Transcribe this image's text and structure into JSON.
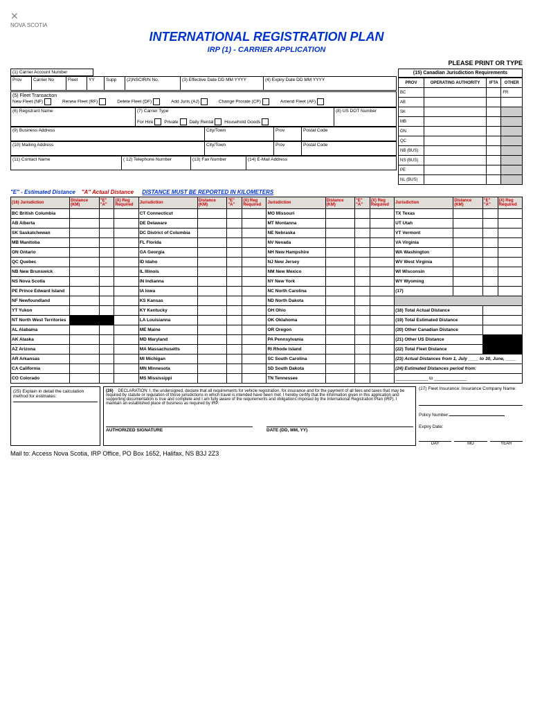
{
  "logo": "NOVA SCOTIA",
  "title": "INTERNATIONAL REGISTRATION PLAN",
  "subtitle": "IRP (1) - CARRIER APPLICATION",
  "print_type": "PLEASE PRINT OR TYPE",
  "carrier_account": "(1) Carrier Account Number",
  "row1": {
    "prov": "Prov",
    "carrier_no": "Carrier No",
    "fleet": "Fleet",
    "yy": "YY",
    "supp": "Supp",
    "nscirn": "(2)NSCIR/N No.",
    "effective": "(3)  Effective Date   DD  MM  YYYY",
    "expiry": "(4)      Expiry Date   DD  MM  YYYY"
  },
  "fleet_trans": {
    "label": "(5) Fleet Transaction",
    "new": "New Fleet (NF)",
    "renew": "Renew Fleet (RF)",
    "delete": "Delete Fleet (DF)",
    "add": "Add Juris (AJ)",
    "change": "Change Prorate (CP)",
    "amend": "Amend Fleet (AF)"
  },
  "registrant": {
    "name": "(6) Registrant Name",
    "carrier_type": "(7) Carrier Type",
    "for_hire": "For Hire",
    "private": "Private",
    "daily": "Daily Rental",
    "household": "Household Goods",
    "usdot": "(8) US DOT Number"
  },
  "business": {
    "label": "(9)  Business Address",
    "city": "City/Town",
    "prov": "Prov",
    "postal": "Postal Code"
  },
  "mailing": {
    "label": "(10)  Mailing Address",
    "city": "City/Town",
    "prov": "Prov",
    "postal": "Postal Code"
  },
  "contact": {
    "name": "(11)  Contact Name",
    "tel": "( 12)  Telephone Number",
    "fax": "(13) Fax Number",
    "email": "(14)  E-Mail Address"
  },
  "canadian_req": {
    "title": "(15) Canadian Jurisdiction Requirements",
    "cols": [
      "PROV",
      "OPERATING AUTHORITY",
      "IFTA",
      "OTHER"
    ],
    "rows": [
      "BC",
      "AB",
      "SK",
      "MB",
      "ON",
      "QC",
      "NB (BUS)",
      "NS (BUS)",
      "PE",
      "NL (BUS)"
    ],
    "bc_other": "FR"
  },
  "legend": {
    "e": "\"E\" - Estimated Distance",
    "a": "\"A\" Actual Distance",
    "km": "DISTANCE MUST BE REPORTED IN KILOMETERS"
  },
  "jur_headers": {
    "num": "(16)",
    "jur": "Jurisdiction",
    "dist": "Distance (KM)",
    "ea": "\"E\" \"A\"",
    "xreg": "(X) Reg Required"
  },
  "col1": [
    {
      "code": "BC",
      "name": "British Columbia"
    },
    {
      "code": "AB",
      "name": "Alberta"
    },
    {
      "code": "SK",
      "name": "Saskatchewan"
    },
    {
      "code": "MB",
      "name": "Manitoba"
    },
    {
      "code": "ON",
      "name": "Ontario"
    },
    {
      "code": "QC",
      "name": "Quebec"
    },
    {
      "code": "NB",
      "name": "New Brunswick"
    },
    {
      "code": "NS",
      "name": "Nova Scotia"
    },
    {
      "code": "PE",
      "name": "Prince Edward Island"
    },
    {
      "code": "NF",
      "name": "Newfoundland"
    },
    {
      "code": "YT",
      "name": "Yukon"
    },
    {
      "code": "NT",
      "name": "North West Territories"
    },
    {
      "code": "AL",
      "name": "Alabama"
    },
    {
      "code": "AK",
      "name": "Alaska"
    },
    {
      "code": "AZ",
      "name": "Arizona"
    },
    {
      "code": "AR",
      "name": "Arkansas"
    },
    {
      "code": "CA",
      "name": "California"
    },
    {
      "code": "CO",
      "name": "Colorado"
    }
  ],
  "col2": [
    {
      "code": "CT",
      "name": "Connecticut"
    },
    {
      "code": "DE",
      "name": "Delaware"
    },
    {
      "code": "DC",
      "name": "District of Columbia"
    },
    {
      "code": "FL",
      "name": "Florida"
    },
    {
      "code": "GA",
      "name": "Georgia"
    },
    {
      "code": "ID",
      "name": "Idaho"
    },
    {
      "code": "IL",
      "name": "Illinois"
    },
    {
      "code": "IN",
      "name": "Indianna"
    },
    {
      "code": "IA",
      "name": "Iowa"
    },
    {
      "code": "KS",
      "name": "Kansas"
    },
    {
      "code": "KY",
      "name": "Kentucky"
    },
    {
      "code": "LA",
      "name": "Louisianna"
    },
    {
      "code": "ME",
      "name": "Maine"
    },
    {
      "code": "MD",
      "name": "Maryland"
    },
    {
      "code": "MA",
      "name": "Massachusetts"
    },
    {
      "code": "MI",
      "name": "Michigan"
    },
    {
      "code": "MN",
      "name": "Minnesota"
    },
    {
      "code": "MS",
      "name": "Mississippi"
    }
  ],
  "col3": [
    {
      "code": "MO",
      "name": "Missouri"
    },
    {
      "code": "MT",
      "name": "Montanna"
    },
    {
      "code": "NE",
      "name": "Nebraska"
    },
    {
      "code": "NV",
      "name": "Nevada"
    },
    {
      "code": "NH",
      "name": "New Hampshire"
    },
    {
      "code": "NJ",
      "name": "New Jersey"
    },
    {
      "code": "NM",
      "name": "New Mexico"
    },
    {
      "code": "NY",
      "name": "New York"
    },
    {
      "code": "NC",
      "name": "North Carolina"
    },
    {
      "code": "ND",
      "name": "North Dakota"
    },
    {
      "code": "OH",
      "name": "Ohio"
    },
    {
      "code": "OK",
      "name": "Oklahoma"
    },
    {
      "code": "OR",
      "name": "Oregon"
    },
    {
      "code": "PA",
      "name": "Pennsylvania"
    },
    {
      "code": "RI",
      "name": "Rhode Island"
    },
    {
      "code": "SC",
      "name": "South Carolina"
    },
    {
      "code": "SD",
      "name": "South Dakota"
    },
    {
      "code": "TN",
      "name": "Tennessee"
    }
  ],
  "col4": [
    {
      "code": "TX",
      "name": "Texas"
    },
    {
      "code": "UT",
      "name": "Utah"
    },
    {
      "code": "VT",
      "name": "Vermont"
    },
    {
      "code": "VA",
      "name": "Virginia"
    },
    {
      "code": "WA",
      "name": "Washington"
    },
    {
      "code": "WV",
      "name": "West Virginia"
    },
    {
      "code": "WI",
      "name": "Wisconsin"
    },
    {
      "code": "WY",
      "name": "Wyoming"
    }
  ],
  "totals": {
    "r17": "(17)",
    "r18": "(18)  Total Actual Distance",
    "r19": "(19)  Total Estimated Distance",
    "r20": "(20)  Other Canadian Distance",
    "r21": "(21)  Other US Distance",
    "r22": "(22)  Total Fleet Distance",
    "r23": "(23)  Actual Distances from 1, July ____ to 30, June, ____",
    "r24": "(24)  Estimated Distances period from:",
    "r24b": "_____________ to _____________"
  },
  "box25": {
    "label": "(25) Explain in detail the calculation method for estimates:"
  },
  "box26": {
    "label": "(26)",
    "decl_title": "DECLARATION:",
    "text": "I, the undersigned, declare that all requirements for vehicle registration, for insurance and for the payment of all fees and taxes that may be required by statute or regulation of those jurisdictions in which travel is intended have been met.  I hereby certify that the information  given in this application and supporting documentation is true and complete  and I am fully aware of the requirements and obligations imposed by the International Registration Plan (IRP).  I maintain an established place of business as required by IRP.",
    "sig": "AUTHORIZED SIGNATURE",
    "date": "DATE (DD, MM, YY)"
  },
  "box27": {
    "label": "(27)  Fleet Insurance:   Insurance Company Name:",
    "policy": "Policy Number:",
    "expiry": "Expiry Date:",
    "day": "DAY",
    "mo": "MO",
    "year": "YEAR"
  },
  "mail_to": "Mail to:   Access Nova Scotia, IRP Office, PO Box 1652, Halifax, NS  B3J 2Z3"
}
